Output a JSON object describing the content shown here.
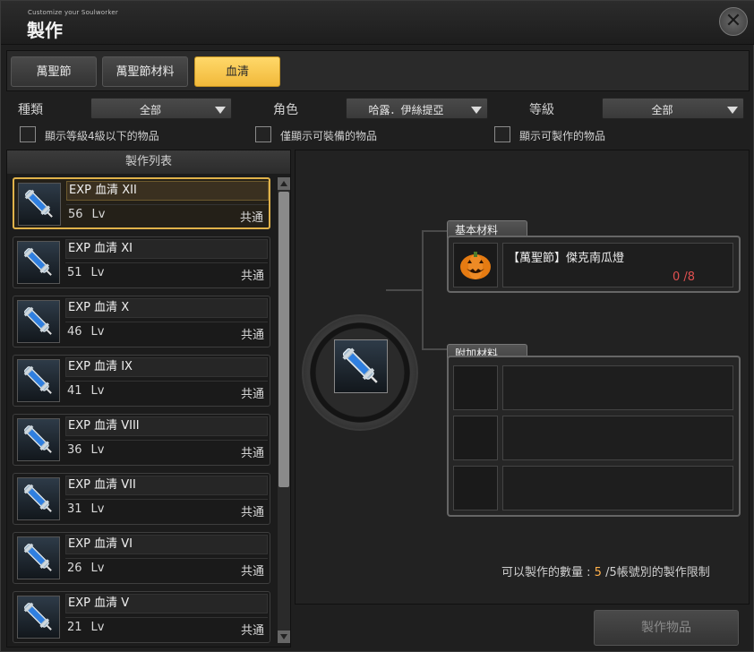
{
  "window": {
    "subtitle": "Customize your Soulworker",
    "title": "製作",
    "close_label": "✕"
  },
  "tabs": [
    {
      "label": "萬聖節",
      "active": false
    },
    {
      "label": "萬聖節材料",
      "active": false
    },
    {
      "label": "血清",
      "active": true
    }
  ],
  "filters": {
    "type_label": "種類",
    "type_value": "全部",
    "role_label": "角色",
    "role_value": "哈露．伊絲提亞",
    "level_label": "等級",
    "level_value": "全部"
  },
  "checkboxes": [
    {
      "label": "顯示等級4級以下的物品",
      "checked": false
    },
    {
      "label": "僅顯示可裝備的物品",
      "checked": false
    },
    {
      "label": "顯示可製作的物品",
      "checked": false
    }
  ],
  "list": {
    "header": "製作列表",
    "items": [
      {
        "name": "EXP 血清 XII",
        "level": "56",
        "lv": "Lv",
        "type": "共通",
        "selected": true
      },
      {
        "name": "EXP 血清 XI",
        "level": "51",
        "lv": "Lv",
        "type": "共通",
        "selected": false
      },
      {
        "name": "EXP 血清 X",
        "level": "46",
        "lv": "Lv",
        "type": "共通",
        "selected": false
      },
      {
        "name": "EXP 血清 IX",
        "level": "41",
        "lv": "Lv",
        "type": "共通",
        "selected": false
      },
      {
        "name": "EXP 血清 VIII",
        "level": "36",
        "lv": "Lv",
        "type": "共通",
        "selected": false
      },
      {
        "name": "EXP 血清 VII",
        "level": "31",
        "lv": "Lv",
        "type": "共通",
        "selected": false
      },
      {
        "name": "EXP 血清 VI",
        "level": "26",
        "lv": "Lv",
        "type": "共通",
        "selected": false
      },
      {
        "name": "EXP 血清 V",
        "level": "21",
        "lv": "Lv",
        "type": "共通",
        "selected": false
      }
    ]
  },
  "detail": {
    "base_tab": "基本材料",
    "base_item_name": "【萬聖節】傑克南瓜燈",
    "base_item_have": "0",
    "base_item_need": "/8",
    "extra_tab": "附加材料",
    "limit_prefix": "可以製作的數量 : ",
    "limit_num": "5",
    "limit_suffix": " /5帳號別的製作限制",
    "make_button": "製作物品"
  },
  "colors": {
    "accent": "#f1b93a",
    "selected_border": "#e0b24a",
    "count_red": "#e05050",
    "limit_orange": "#ffb04a"
  }
}
